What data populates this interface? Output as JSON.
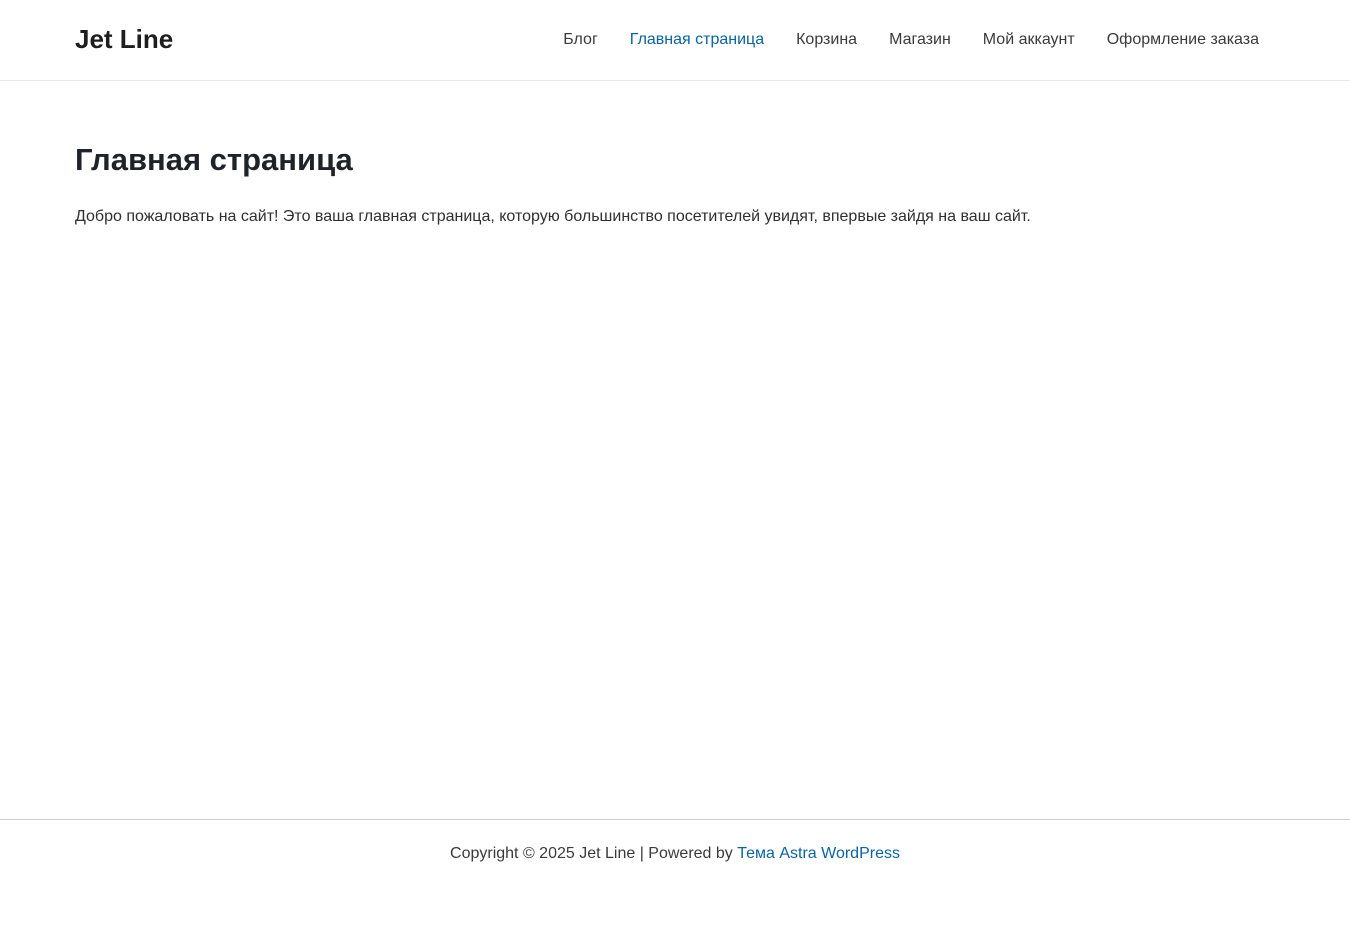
{
  "header": {
    "site_title": "Jet Line",
    "nav": {
      "blog": "Блог",
      "home": "Главная страница",
      "cart": "Корзина",
      "shop": "Магазин",
      "account": "Мой аккаунт",
      "checkout": "Оформление заказа"
    },
    "current_item": "Главная страница"
  },
  "main": {
    "title": "Главная страница",
    "text": "Добро пожаловать на сайт! Это ваша главная страница, которую большинство посетителей увидят, впервые зайдя на ваш сайт."
  },
  "footer": {
    "copyright": "Copyright © 2025 Jet Line | Powered by ",
    "theme_link": "Тема Astra WordPress"
  },
  "colors": {
    "link_accent": "#0a63a5",
    "text": "#3a3a3a",
    "heading": "#1e2229"
  }
}
